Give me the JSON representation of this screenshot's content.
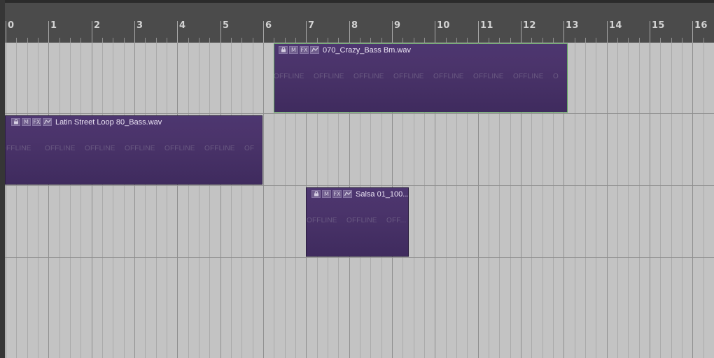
{
  "ruler": {
    "bars": [
      "0",
      "1",
      "2",
      "3",
      "4",
      "5",
      "6",
      "7",
      "8",
      "9",
      "10",
      "11",
      "12",
      "13",
      "14",
      "15",
      "16"
    ]
  },
  "clips": [
    {
      "name": "070_Crazy_Bass Bm.wav",
      "selected": true,
      "buttons": {
        "lock": "lock-icon",
        "mute": "M",
        "fx": "FX",
        "envelope": "envelope-icon"
      },
      "offline_labels": [
        "OFFLINE",
        "OFFLINE",
        "OFFLINE",
        "OFFLINE",
        "OFFLINE",
        "OFFLINE",
        "OFFLINE",
        "O"
      ]
    },
    {
      "name": "Latin Street Loop 80_Bass.wav",
      "selected": false,
      "buttons": {
        "lock": "lock-icon",
        "mute": "M",
        "fx": "FX",
        "envelope": "envelope-icon"
      },
      "offline_labels": [
        "OFFLINE",
        "OFFLINE",
        "OFFLINE",
        "OFFLINE",
        "OFFLINE",
        "OFFLINE",
        "OF"
      ]
    },
    {
      "name": "Salsa 01_100...",
      "selected": false,
      "buttons": {
        "lock": "lock-icon",
        "mute": "M",
        "fx": "FX",
        "envelope": "envelope-icon"
      },
      "offline_labels": [
        "OFFLINE",
        "OFFLINE",
        "OFF..."
      ]
    }
  ],
  "colors": {
    "clip": "#4b346b",
    "selected_border": "#5ea45e",
    "background": "#c3c3c3",
    "ruler": "#4b4b4b"
  }
}
